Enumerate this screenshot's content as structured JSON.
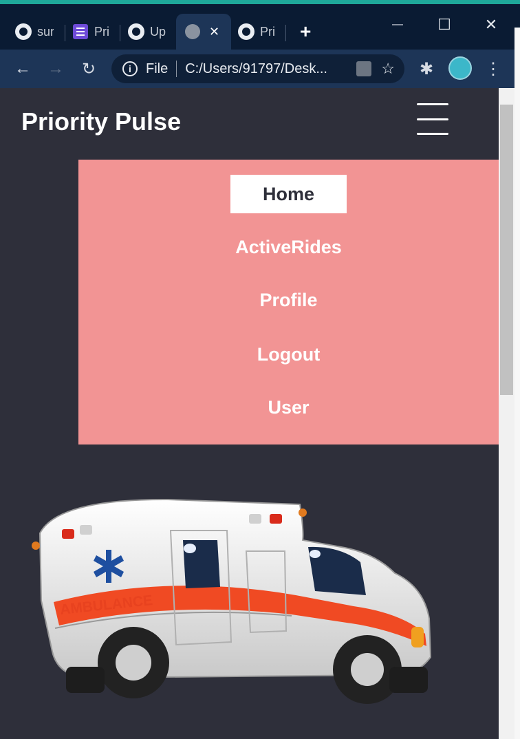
{
  "browser": {
    "tabs": [
      {
        "label": "sur",
        "icon": "github-icon"
      },
      {
        "label": "Pri",
        "icon": "forms-icon"
      },
      {
        "label": "Up",
        "icon": "github-icon"
      },
      {
        "label": "",
        "icon": "globe-icon",
        "active": true
      },
      {
        "label": "Pri",
        "icon": "github-icon"
      }
    ],
    "new_tab": "+",
    "active_tab_close": "✕",
    "window_controls": {
      "minimize": "—",
      "maximize": "☐",
      "close": "✕"
    },
    "toolbar": {
      "back": "←",
      "forward": "→",
      "reload": "↻",
      "site_info": "i",
      "scheme_label": "File",
      "url": "C:/Users/91797/Desk...",
      "star": "☆",
      "extensions": "✱",
      "menu": "⋮"
    }
  },
  "page": {
    "brand": "Priority Pulse",
    "menu": {
      "items": [
        "Home",
        "ActiveRides",
        "Profile",
        "Logout",
        "User"
      ],
      "active_item": "Home",
      "background": "#f29494"
    },
    "hero_image": {
      "text": "AMBULANCE",
      "icon": "ambulance-illustration"
    },
    "background": "#2e2f3a"
  }
}
